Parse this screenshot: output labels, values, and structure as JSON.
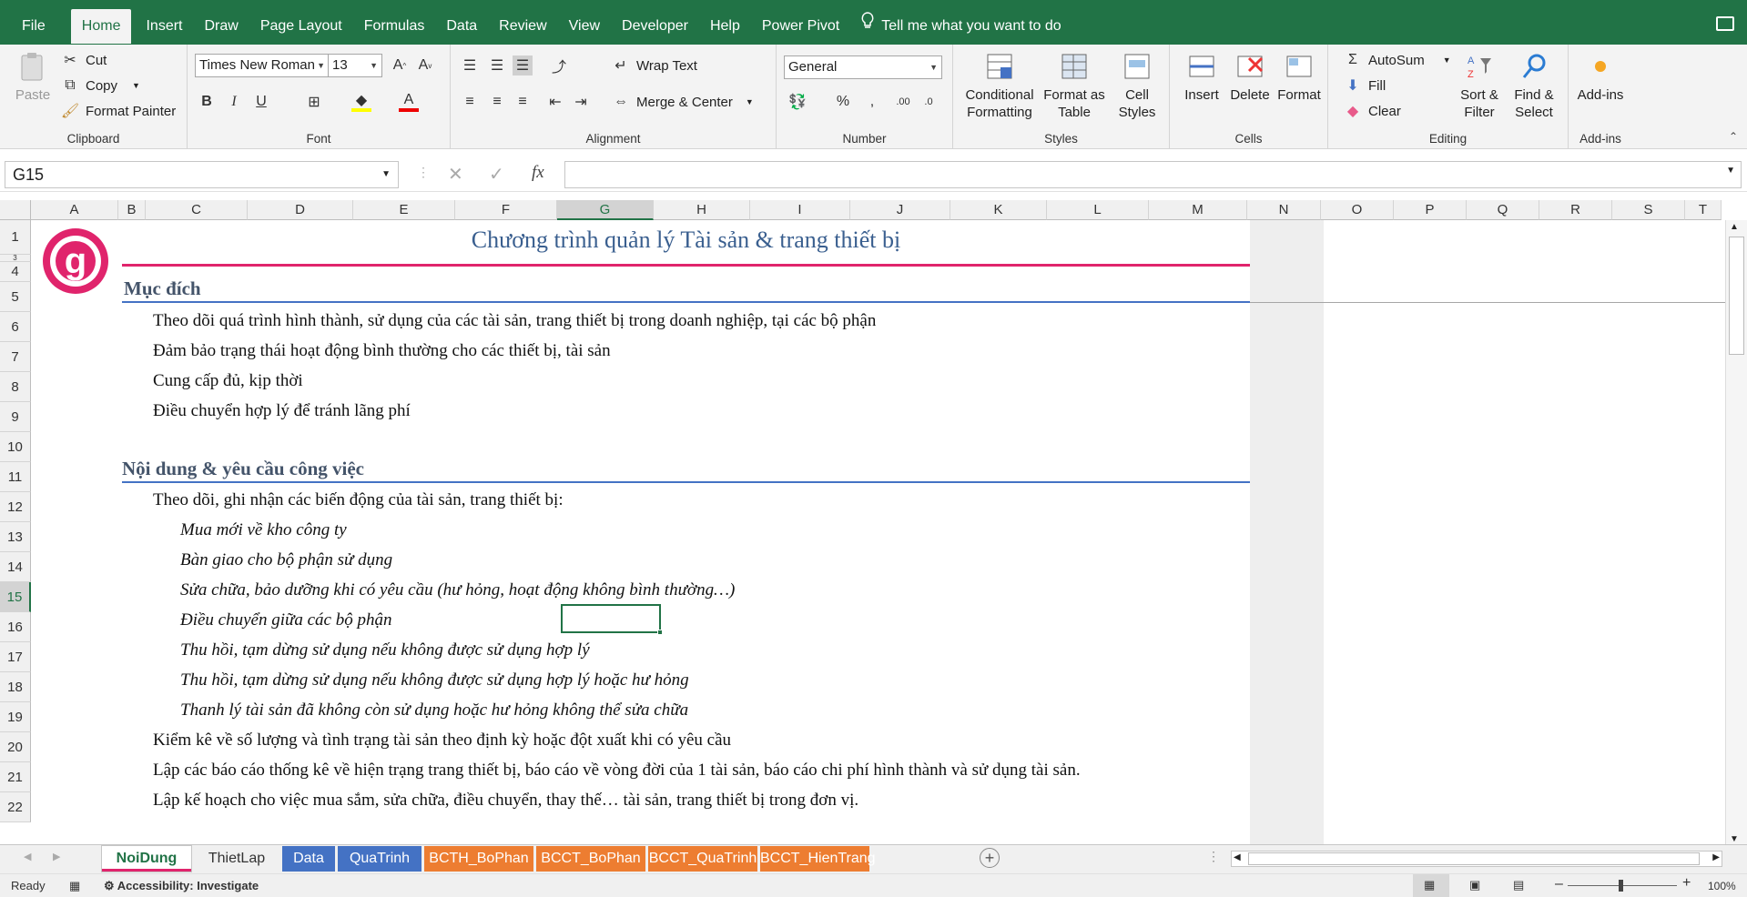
{
  "menu": {
    "tabs": [
      "File",
      "Home",
      "Insert",
      "Draw",
      "Page Layout",
      "Formulas",
      "Data",
      "Review",
      "View",
      "Developer",
      "Help",
      "Power Pivot"
    ],
    "tell_me": "Tell me what you want to do"
  },
  "ribbon": {
    "clipboard": {
      "label": "Clipboard",
      "paste": "Paste",
      "cut": "Cut",
      "copy": "Copy",
      "format_painter": "Format Painter"
    },
    "font": {
      "label": "Font",
      "name": "Times New Roman",
      "size": "13"
    },
    "alignment": {
      "label": "Alignment",
      "wrap_text": "Wrap Text",
      "merge_center": "Merge & Center"
    },
    "number": {
      "label": "Number",
      "format": "General"
    },
    "styles": {
      "label": "Styles",
      "conditional": "Conditional",
      "formatting": "Formatting",
      "format_as": "Format as",
      "table": "Table",
      "cell": "Cell",
      "styles_btn": "Styles"
    },
    "cells": {
      "label": "Cells",
      "insert": "Insert",
      "delete": "Delete",
      "format": "Format"
    },
    "editing": {
      "label": "Editing",
      "autosum": "AutoSum",
      "fill": "Fill",
      "clear": "Clear",
      "sort": "Sort &",
      "filter": "Filter",
      "find": "Find &",
      "select": "Select"
    },
    "addins": {
      "label": "Add-ins",
      "btn": "Add-ins"
    }
  },
  "formula_bar": {
    "name_box": "G15",
    "fx": "fx",
    "content": ""
  },
  "columns": [
    "A",
    "B",
    "C",
    "D",
    "E",
    "F",
    "G",
    "H",
    "I",
    "J",
    "K",
    "L",
    "M",
    "N",
    "O",
    "P",
    "Q",
    "R",
    "S",
    "T"
  ],
  "rows": [
    "1",
    "3",
    "4",
    "5",
    "6",
    "7",
    "8",
    "9",
    "10",
    "11",
    "12",
    "13",
    "14",
    "15",
    "16",
    "17",
    "18",
    "19",
    "20",
    "21",
    "22"
  ],
  "sheet": {
    "logo_letter": "g",
    "title": "Chương trình quản lý Tài sản & trang thiết bị",
    "section1": "Mục đích",
    "purpose": [
      "Theo dõi quá trình hình thành, sử dụng của các tài sản, trang thiết bị trong doanh nghiệp, tại các bộ phận",
      "Đảm bảo trạng thái hoạt động bình thường cho các thiết bị, tài sản",
      "Cung cấp đủ, kịp thời",
      "Điều chuyển hợp lý để tránh lãng phí"
    ],
    "section2": "Nội dung & yêu cầu công việc",
    "req_intro": "Theo dõi, ghi nhận các biến động của tài sản, trang thiết bị:",
    "req_items": [
      "Mua mới về kho công ty",
      "Bàn giao cho bộ phận sử dụng",
      "Sửa chữa, bảo dưỡng khi có yêu cầu (hư hỏng, hoạt động không bình thường…)",
      "Điều chuyển giữa các bộ phận",
      "Thu hồi, tạm dừng sử dụng nếu không được sử dụng hợp lý",
      "Thu hồi, tạm dừng sử dụng nếu không được sử dụng hợp lý hoặc hư hỏng",
      "Thanh lý tài sản đã không còn sử dụng hoặc hư hỏng không thể sửa chữa"
    ],
    "req_more": [
      "Kiểm kê về số lượng và tình trạng tài sản theo định kỳ hoặc đột xuất khi có yêu cầu",
      "Lập các báo cáo thống kê về hiện trạng trang thiết bị, báo cáo về vòng đời của 1 tài sản, báo cáo chi phí hình thành và sử dụng tài sản.",
      "Lập kế hoạch cho việc mua sắm, sửa chữa, điều chuyển, thay thế… tài sản, trang thiết bị trong đơn vị."
    ]
  },
  "sheet_tabs": [
    {
      "label": "NoiDung",
      "color": "#ffffff"
    },
    {
      "label": "ThietLap",
      "color": "#f0f0f0"
    },
    {
      "label": "Data",
      "color": "#4472c4"
    },
    {
      "label": "QuaTrinh",
      "color": "#4472c4"
    },
    {
      "label": "BCTH_BoPhan",
      "color": "#ed7d31"
    },
    {
      "label": "BCCT_BoPhan",
      "color": "#ed7d31"
    },
    {
      "label": "BCCT_QuaTrinh",
      "color": "#ed7d31"
    },
    {
      "label": "BCCT_HienTrang",
      "color": "#ed7d31"
    }
  ],
  "status": {
    "ready": "Ready",
    "accessibility": "Accessibility: Investigate",
    "zoom": "100%"
  },
  "colors": {
    "excel_green": "#217346",
    "accent_pink": "#e0246c",
    "heading_blue": "#44546a",
    "line_blue": "#4472c4"
  }
}
